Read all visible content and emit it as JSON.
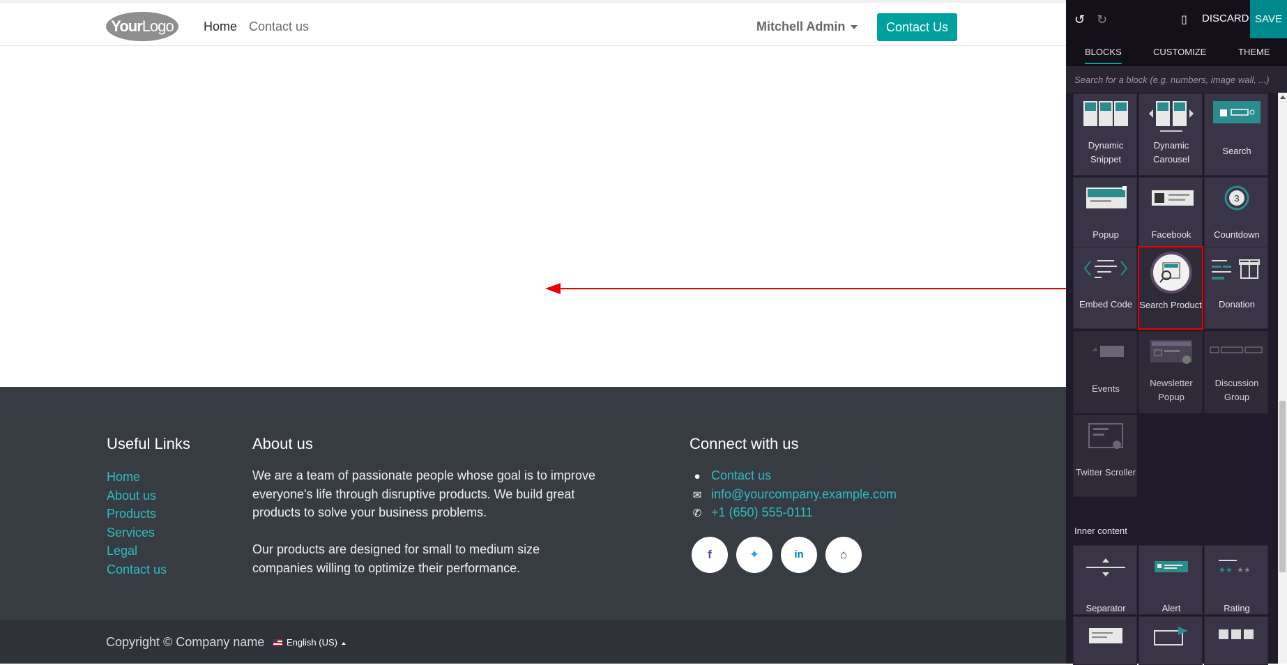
{
  "header": {
    "logo_text_bold": "Your",
    "logo_text_thin": "Logo",
    "nav": [
      "Home",
      "Contact us"
    ],
    "user": "Mitchell Admin",
    "cta": "Contact Us"
  },
  "footer": {
    "useful_links_title": "Useful Links",
    "links": [
      "Home",
      "About us",
      "Products",
      "Services",
      "Legal",
      "Contact us"
    ],
    "about_title": "About us",
    "about_p1": "We are a team of passionate people whose goal is to improve everyone's life through disruptive products. We build great products to solve your business problems.",
    "about_p2": "Our products are designed for small to medium size companies willing to optimize their performance.",
    "connect_title": "Connect with us",
    "connect": {
      "contact": "Contact us",
      "email": "info@yourcompany.example.com",
      "phone": "+1 (650) 555-0111"
    },
    "socials": [
      "facebook-icon",
      "twitter-icon",
      "linkedin-icon",
      "home-icon"
    ],
    "copyright": "Copyright © Company name",
    "language": "English (US)"
  },
  "panel": {
    "discard": "DISCARD",
    "save": "SAVE",
    "tabs": [
      "BLOCKS",
      "CUSTOMIZE",
      "THEME"
    ],
    "search_placeholder": "Search for a block (e.g. numbers, image wall, ...)",
    "blocks": [
      "Dynamic Snippet",
      "Dynamic Carousel",
      "Search",
      "Popup",
      "Facebook",
      "Countdown",
      "Embed Code",
      "Search Product",
      "Donation",
      "Events",
      "Newsletter Popup",
      "Discussion Group",
      "Twitter Scroller"
    ],
    "inner_content_title": "Inner content",
    "inner_blocks": [
      "Separator",
      "Alert",
      "Rating"
    ]
  },
  "colors": {
    "accent": "#00a09d",
    "footer_bg": "#373c43",
    "panel_bg": "#1f1b2a",
    "annotation": "#e00000"
  }
}
